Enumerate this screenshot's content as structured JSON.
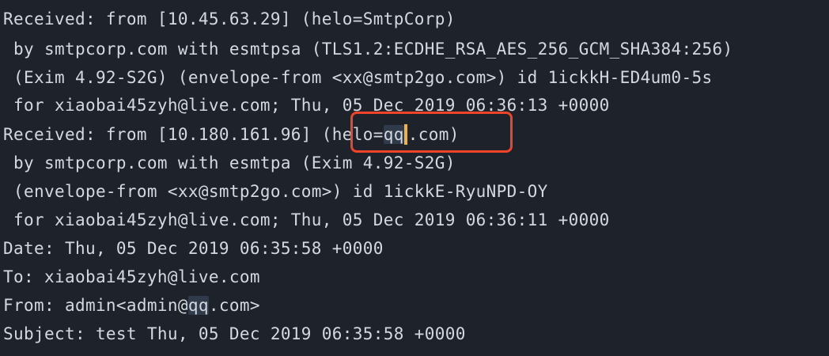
{
  "colors": {
    "background": "#1e222a",
    "text": "#d4d8df",
    "highlight": "#2f3a4b",
    "cursor": "#f0b43c",
    "annotation": "#f0442a"
  },
  "lines": [
    {
      "text": "Received: from [10.45.63.29] (helo=SmtpCorp)"
    },
    {
      "text": " by smtpcorp.com with esmtpsa (TLS1.2:ECDHE_RSA_AES_256_GCM_SHA384:256)"
    },
    {
      "text": " (Exim 4.92-S2G) (envelope-from <xx@smtp2go.com>) id 1ickkH-ED4um0-5s"
    },
    {
      "text": " for xiaobai45zyh@live.com; Thu, 05 Dec 2019 06:36:13 +0000"
    },
    {
      "pre": "Received: from [10.180.161.96] (helo=",
      "hl": "qq",
      "post": ".com)"
    },
    {
      "text": " by smtpcorp.com with esmtpa (Exim 4.92-S2G)"
    },
    {
      "text": " (envelope-from <xx@smtp2go.com>) id 1ickkE-RyuNPD-OY"
    },
    {
      "text": " for xiaobai45zyh@live.com; Thu, 05 Dec 2019 06:36:11 +0000"
    },
    {
      "text": "Date: Thu, 05 Dec 2019 06:35:58 +0000"
    },
    {
      "text": "To: xiaobai45zyh@live.com"
    },
    {
      "pre": "From: admin<admin@",
      "hl": "qq",
      "post": ".com>"
    },
    {
      "text": "Subject: test Thu, 05 Dec 2019 06:35:58 +0000"
    }
  ]
}
